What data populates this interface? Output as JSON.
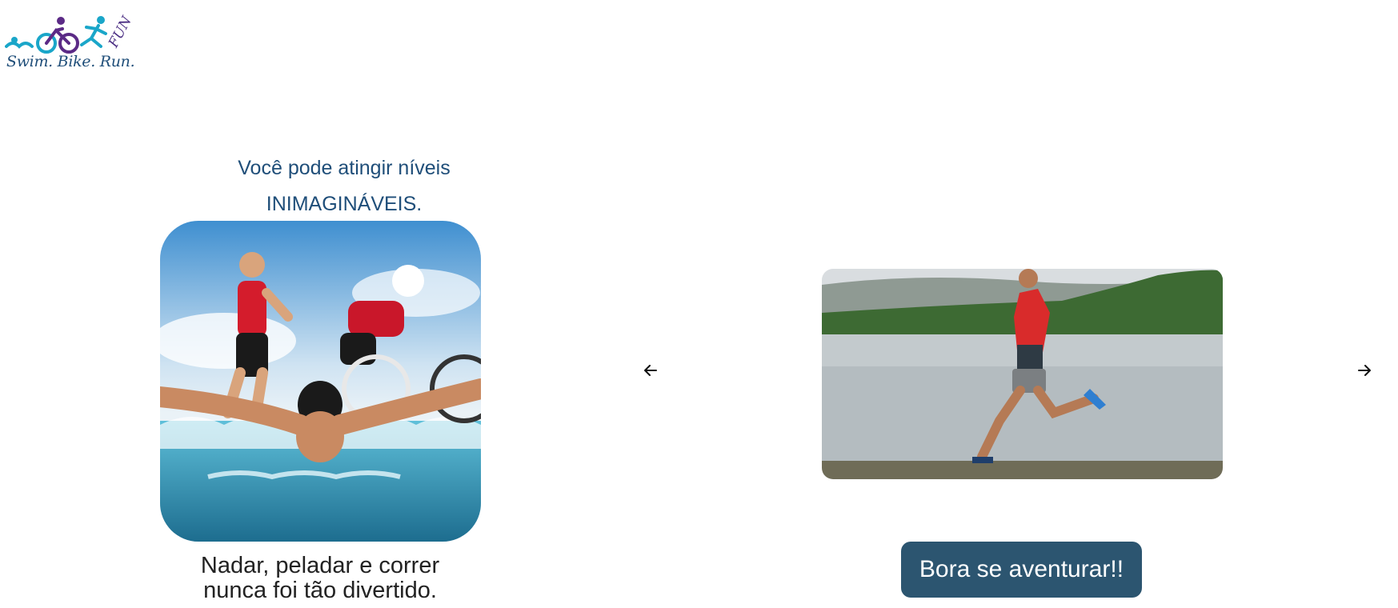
{
  "brand": {
    "logo_text": "Swim. Bike. Run.",
    "logo_badge": "FUN",
    "colors": {
      "teal": "#1aa6c9",
      "purple": "#5b2a86",
      "navy": "#1f4e79"
    }
  },
  "hero": {
    "tagline_line1": "Você pode atingir níveis",
    "tagline_line2": "INIMAGINÁVEIS.",
    "caption_line1": "Nadar, peladar e correr",
    "caption_line2": "nunca foi tão divertido."
  },
  "carousel": {
    "prev_icon": "arrow-left-icon",
    "next_icon": "arrow-right-icon"
  },
  "cta": {
    "label": "Bora se aventurar!!",
    "color": "#2c5570"
  }
}
